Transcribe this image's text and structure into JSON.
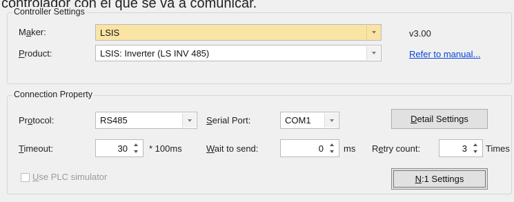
{
  "top_text": "controlador con el que se va a comunicar.",
  "controller": {
    "title": "Controller Settings",
    "maker_label_pre": "M",
    "maker_label_mid": "a",
    "maker_label_post": "ker:",
    "maker_value": "LSIS",
    "version": "v3.00",
    "product_label_mid": "P",
    "product_label_post": "roduct:",
    "product_value": "LSIS: Inverter (LS INV 485)",
    "manual_link": "Refer to manual..."
  },
  "connection": {
    "title": "Connection Property",
    "protocol_label_pre": "Pr",
    "protocol_label_mid": "o",
    "protocol_label_post": "tocol:",
    "protocol_value": "RS485",
    "serial_port_label_mid": "S",
    "serial_port_label_post": "erial Port:",
    "serial_port_value": "COM1",
    "detail_button_mid": "D",
    "detail_button_post": "etail Settings",
    "timeout_label_mid": "T",
    "timeout_label_post": "imeout:",
    "timeout_value": "30",
    "timeout_unit": "* 100ms",
    "wait_label_mid": "W",
    "wait_label_post": "ait to send:",
    "wait_value": "0",
    "wait_unit": "ms",
    "retry_label_pre": "R",
    "retry_label_mid": "e",
    "retry_label_post": "try count:",
    "retry_value": "3",
    "retry_unit": "Times",
    "simulator_label_mid": "U",
    "simulator_label_post": "se PLC simulator",
    "n1_button_mid": "N",
    "n1_button_post": ":1 Settings"
  }
}
